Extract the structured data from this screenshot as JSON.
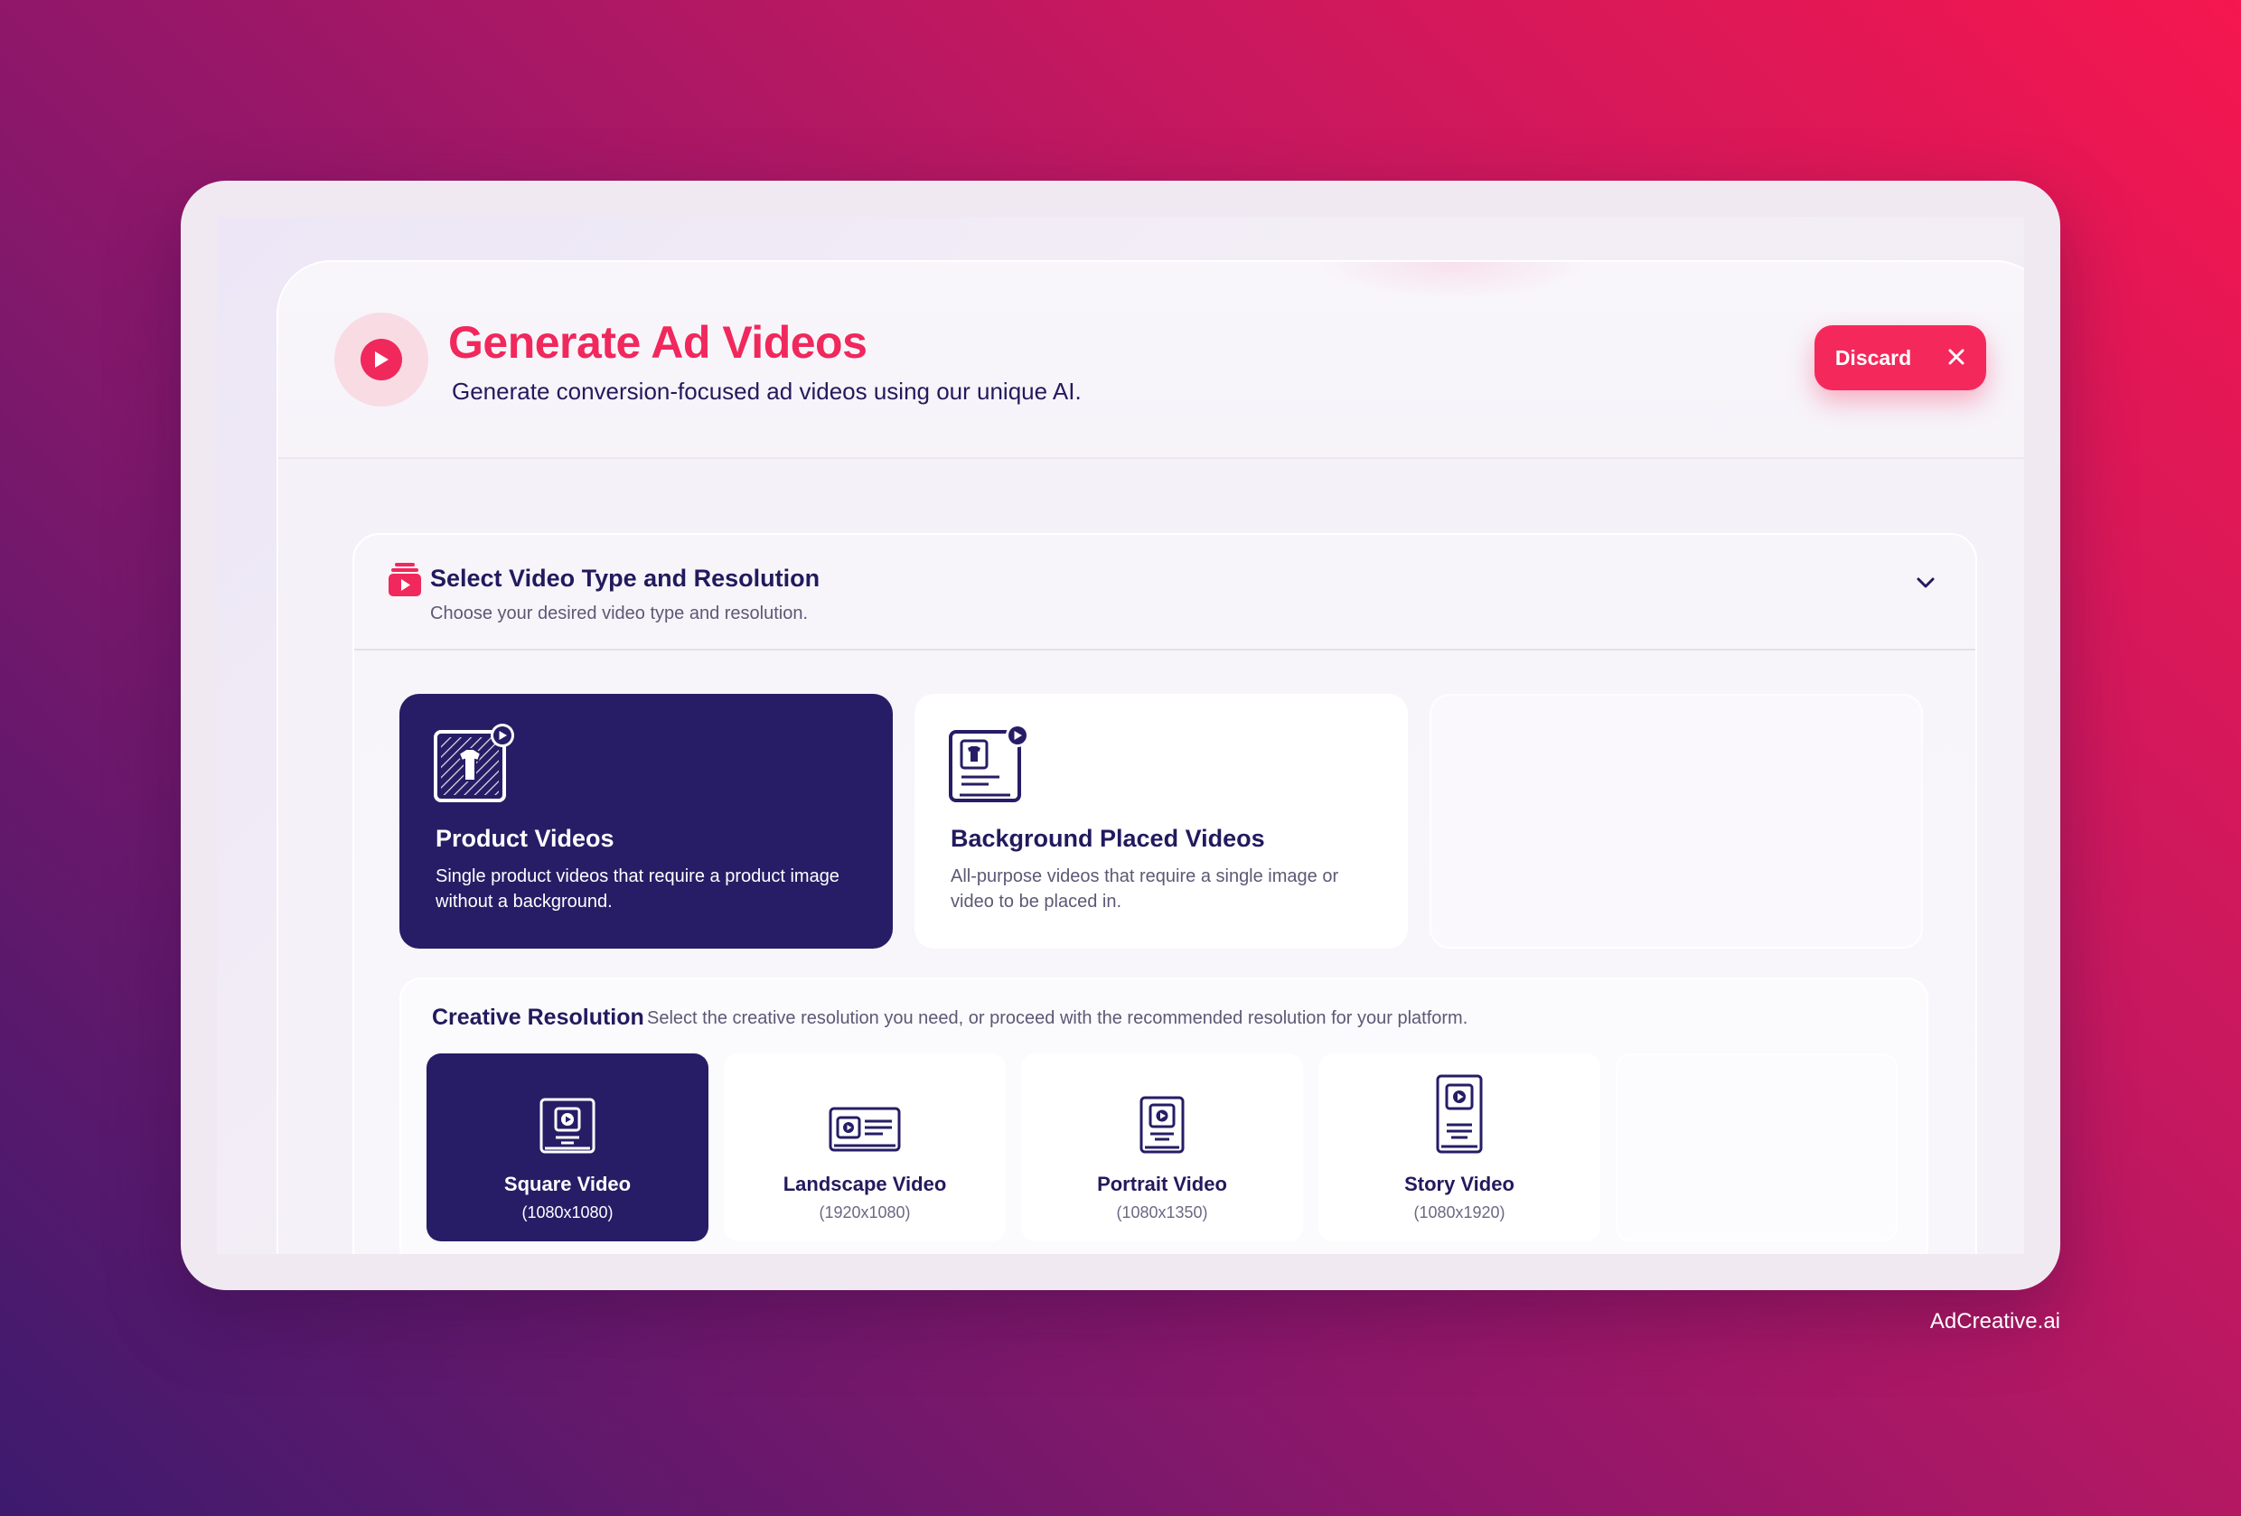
{
  "header": {
    "title": "Generate Ad Videos",
    "subtitle": "Generate conversion-focused ad videos using our unique AI.",
    "icon": "play-circle-icon",
    "discard_label": "Discard",
    "discard_icon": "close-icon"
  },
  "section": {
    "icon": "video-stack-icon",
    "title": "Select Video Type and Resolution",
    "subtitle": "Choose your desired video type and resolution.",
    "toggle_icon": "chevron-down-icon"
  },
  "video_types": [
    {
      "title": "Product Videos",
      "description": "Single product videos that require a product image without a background.",
      "icon": "product-video-icon",
      "selected": true
    },
    {
      "title": "Background Placed Videos",
      "description": "All-purpose videos that require a single image or video to be placed in.",
      "icon": "background-video-icon",
      "selected": false
    }
  ],
  "resolution": {
    "title": "Creative Resolution",
    "subtitle": "Select the creative resolution you need, or proceed with the recommended resolution for your platform.",
    "options": [
      {
        "name": "Square Video",
        "dimensions": "(1080x1080)",
        "icon": "square-video-icon",
        "selected": true
      },
      {
        "name": "Landscape Video",
        "dimensions": "(1920x1080)",
        "icon": "landscape-video-icon",
        "selected": false
      },
      {
        "name": "Portrait Video",
        "dimensions": "(1080x1350)",
        "icon": "portrait-video-icon",
        "selected": false
      },
      {
        "name": "Story Video",
        "dimensions": "(1080x1920)",
        "icon": "story-video-icon",
        "selected": false
      }
    ]
  },
  "watermark": "AdCreative.ai",
  "colors": {
    "accent": "#f0285c",
    "navy": "#261d66",
    "text_dark": "#221a5e",
    "text_muted": "#5d5875"
  }
}
